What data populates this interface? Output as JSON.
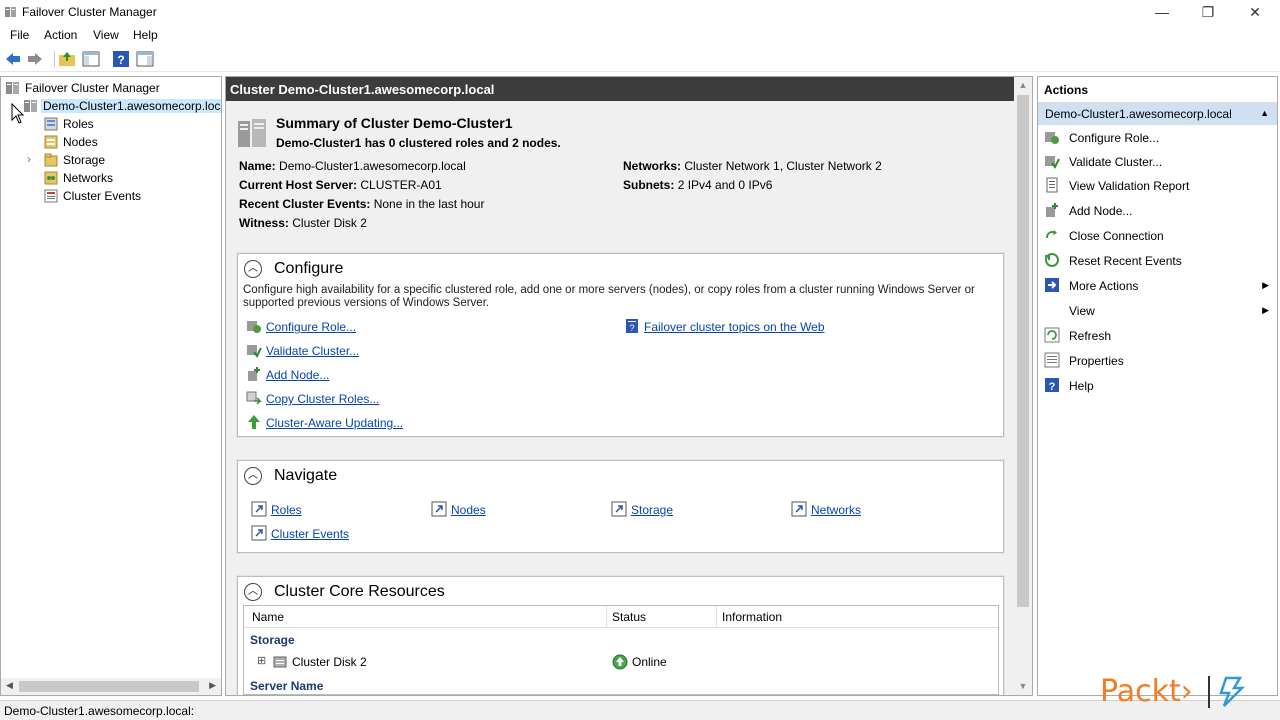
{
  "window": {
    "title": "Failover Cluster Manager",
    "minimize": "—",
    "restore": "❐",
    "close": "✕"
  },
  "menu": [
    "File",
    "Action",
    "View",
    "Help"
  ],
  "tree": {
    "root": "Failover Cluster Manager",
    "cluster": "Demo-Cluster1.awesomecorp.loca",
    "children": [
      "Roles",
      "Nodes",
      "Storage",
      "Networks",
      "Cluster Events"
    ],
    "expand_glyph": "›"
  },
  "center": {
    "header": "Cluster Demo-Cluster1.awesomecorp.local",
    "summary_title": "Summary of Cluster Demo-Cluster1",
    "summary_sub": "Demo-Cluster1 has 0 clustered roles and 2 nodes.",
    "fields": {
      "name_k": "Name:",
      "name_v": "Demo-Cluster1.awesomecorp.local",
      "host_k": "Current Host Server:",
      "host_v": "CLUSTER-A01",
      "events_k": "Recent Cluster Events:",
      "events_v": "None in the last hour",
      "witness_k": "Witness:",
      "witness_v": "Cluster Disk 2",
      "networks_k": "Networks:",
      "networks_v": "Cluster Network 1, Cluster Network 2",
      "subnets_k": "Subnets:",
      "subnets_v": "2 IPv4 and 0 IPv6"
    },
    "configure": {
      "title": "Configure",
      "desc": "Configure high availability for a specific clustered role, add one or more servers (nodes), or copy roles from a cluster running Windows Server or supported previous versions of Windows Server.",
      "links": [
        "Configure Role...",
        "Validate Cluster...",
        "Add Node...",
        "Copy Cluster Roles...",
        "Cluster-Aware Updating..."
      ],
      "web_link": "Failover cluster topics on the Web"
    },
    "navigate": {
      "title": "Navigate",
      "links": [
        "Roles",
        "Nodes",
        "Storage",
        "Networks",
        "Cluster Events"
      ]
    },
    "core": {
      "title": "Cluster Core Resources",
      "columns": [
        "Name",
        "Status",
        "Information"
      ],
      "group_storage": "Storage",
      "disk_name": "Cluster Disk 2",
      "disk_status": "Online",
      "group_server": "Server Name",
      "expand": "⊞"
    },
    "collapse_glyph": "︿",
    "scroll_up": "▲",
    "scroll_down": "▼"
  },
  "actions": {
    "title": "Actions",
    "section": "Demo-Cluster1.awesomecorp.local",
    "section_caret": "▲",
    "items": [
      "Configure Role...",
      "Validate Cluster...",
      "View Validation Report",
      "Add Node...",
      "Close Connection",
      "Reset Recent Events",
      "More Actions",
      "View",
      "Refresh",
      "Properties",
      "Help"
    ],
    "submenu_glyph": "▶"
  },
  "status": "Demo-Cluster1.awesomecorp.local:",
  "watermark": "Packt›",
  "colors": {
    "header_bg": "#3c3c3c",
    "link": "#0645ad",
    "action_highlight": "#cfe0f2",
    "brand": "#f07d24"
  }
}
